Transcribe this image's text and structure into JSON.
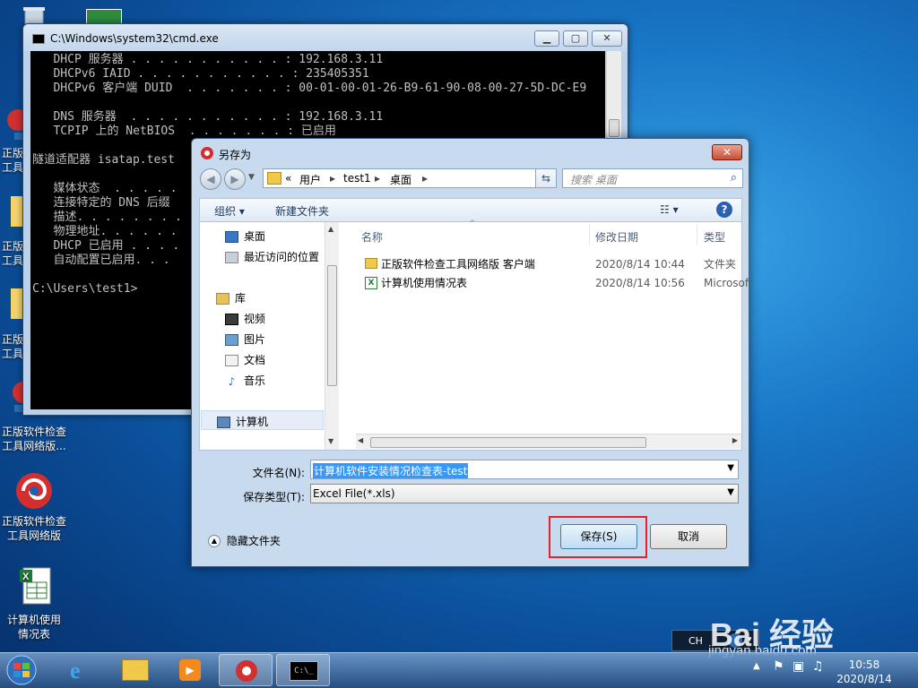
{
  "desktop": {
    "icons": [
      {
        "label": "正版软件检查工具网络版...",
        "icon": "app-icon-red-swirl"
      },
      {
        "label": "正版软件检查工具网络版",
        "icon": "app-icon-swirl"
      },
      {
        "label": "计算机使用情况表",
        "icon": "excel-file-icon"
      }
    ],
    "partial_labels": [
      "正版 工具",
      "正版 工具",
      "正版 工具"
    ]
  },
  "cmd": {
    "title": "C:\\Windows\\system32\\cmd.exe",
    "lines": [
      "   DHCP 服务器 . . . . . . . . . . . : 192.168.3.11",
      "   DHCPv6 IAID . . . . . . . . . . . : 235405351",
      "   DHCPv6 客户端 DUID  . . . . . . . : 00-01-00-01-26-B9-61-90-08-00-27-5D-DC-E9",
      "",
      "   DNS 服务器  . . . . . . . . . . . : 192.168.3.11",
      "   TCPIP 上的 NetBIOS  . . . . . . . : 已启用",
      "",
      "隧道适配器 isatap.test",
      "",
      "   媒体状态  . . . . .",
      "   连接特定的 DNS 后缀",
      "   描述. . . . . . . .",
      "   物理地址. . . . . .",
      "   DHCP 已启用 . . . .",
      "   自动配置已启用. . .",
      "",
      "C:\\Users\\test1>"
    ]
  },
  "dialog": {
    "title": "另存为",
    "close": "✕",
    "address": {
      "chevron": "«",
      "parts": [
        "用户",
        "test1",
        "桌面"
      ]
    },
    "search_placeholder": "搜索 桌面",
    "toolbar": {
      "organize": "组织 ▾",
      "new_folder": "新建文件夹"
    },
    "nav": {
      "favorites": [
        "桌面",
        "最近访问的位置"
      ],
      "library": "库",
      "libs": [
        "视频",
        "图片",
        "文档",
        "音乐"
      ],
      "computer": "计算机"
    },
    "columns": {
      "name": "名称",
      "date": "修改日期",
      "type": "类型"
    },
    "files": [
      {
        "name": "正版软件检查工具网络版 客户端",
        "date": "2020/8/14 10:44",
        "type": "文件夹",
        "icon": "folder-icon"
      },
      {
        "name": "计算机使用情况表",
        "date": "2020/8/14 10:56",
        "type": "Microsof",
        "icon": "excel-file-icon"
      }
    ],
    "filename_label": "文件名(N):",
    "filename_value": "计算机软件安装情况检查表-test",
    "filetype_label": "保存类型(T):",
    "filetype_value": "Excel File(*.xls)",
    "hide_folders": "隐藏文件夹",
    "save_button": "保存(S)",
    "cancel_button": "取消"
  },
  "taskbar": {
    "clock_time": "10:58",
    "clock_date": "2020/8/14",
    "lang": "CH"
  },
  "watermark": {
    "brand": "Bai 经验",
    "sub": "jingyan.baidu.com"
  },
  "colors": {
    "highlight": "#e8202a",
    "selection": "#3399ff"
  }
}
